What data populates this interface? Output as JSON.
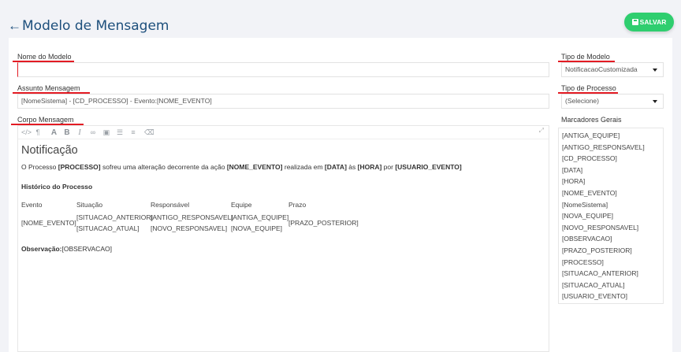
{
  "header": {
    "title": "Modelo de Mensagem",
    "back_icon": "arrow-left-icon",
    "save_label": "SALVAR",
    "save_icon": "floppy-icon"
  },
  "form": {
    "nome_label": "Nome do Modelo",
    "nome_value": "",
    "assunto_label": "Assunto Mensagem",
    "assunto_value": "[NomeSistema] - [CD_PROCESSO] - Evento:[NOME_EVENTO]",
    "corpo_label": "Corpo Mensagem",
    "tipo_modelo_label": "Tipo de Modelo",
    "tipo_modelo_value": "NotificacaoCustomizada",
    "tipo_processo_label": "Tipo de Processo",
    "tipo_processo_value": "(Selecione)",
    "marcadores_label": "Marcadores Gerais"
  },
  "editor": {
    "toolbar": [
      "code-icon",
      "paragraph-icon",
      "font-size-icon",
      "bold-icon",
      "italic-icon",
      "link-icon",
      "image-icon",
      "bullet-list-icon",
      "numbered-list-icon",
      "clear-format-icon",
      "expand-icon"
    ],
    "heading": "Notificação",
    "p1_a": "O Processo ",
    "p1_b": "[PROCESSO]",
    "p1_c": " sofreu uma alteração decorrente da ação ",
    "p1_d": "[NOME_EVENTO]",
    "p1_e": " realizada em ",
    "p1_f": "[DATA]",
    "p1_g": " às ",
    "p1_h": "[HORA]",
    "p1_i": " por ",
    "p1_j": "[USUARIO_EVENTO]",
    "historico": "Histórico do Processo",
    "table": {
      "headers": [
        "Evento",
        "Situação",
        "Responsável",
        "Equipe",
        "Prazo"
      ],
      "evento": "[NOME_EVENTO]",
      "situacao_1": "[SITUACAO_ANTERIOR]",
      "situacao_2": "[SITUACAO_ATUAL]",
      "responsavel_1": "[ANTIGO_RESPONSAVEL]",
      "responsavel_2": "[NOVO_RESPONSAVEL]",
      "equipe_1": "[ANTIGA_EQUIPE]",
      "equipe_2": "[NOVA_EQUIPE]",
      "prazo": "[PRAZO_POSTERIOR]"
    },
    "obs_label": "Observação:",
    "obs_value": "[OBSERVACAO]"
  },
  "markers": [
    "[ANTIGA_EQUIPE]",
    "[ANTIGO_RESPONSAVEL]",
    "[CD_PROCESSO]",
    "[DATA]",
    "[HORA]",
    "[NOME_EVENTO]",
    "[NomeSistema]",
    "[NOVA_EQUIPE]",
    "[NOVO_RESPONSAVEL]",
    "[OBSERVACAO]",
    "[PRAZO_POSTERIOR]",
    "[PROCESSO]",
    "[SITUACAO_ANTERIOR]",
    "[SITUACAO_ATUAL]",
    "[USUARIO_EVENTO]"
  ],
  "colors": {
    "accent": "#1d4f7c",
    "save": "#2fce6f",
    "required": "#e31b23"
  }
}
